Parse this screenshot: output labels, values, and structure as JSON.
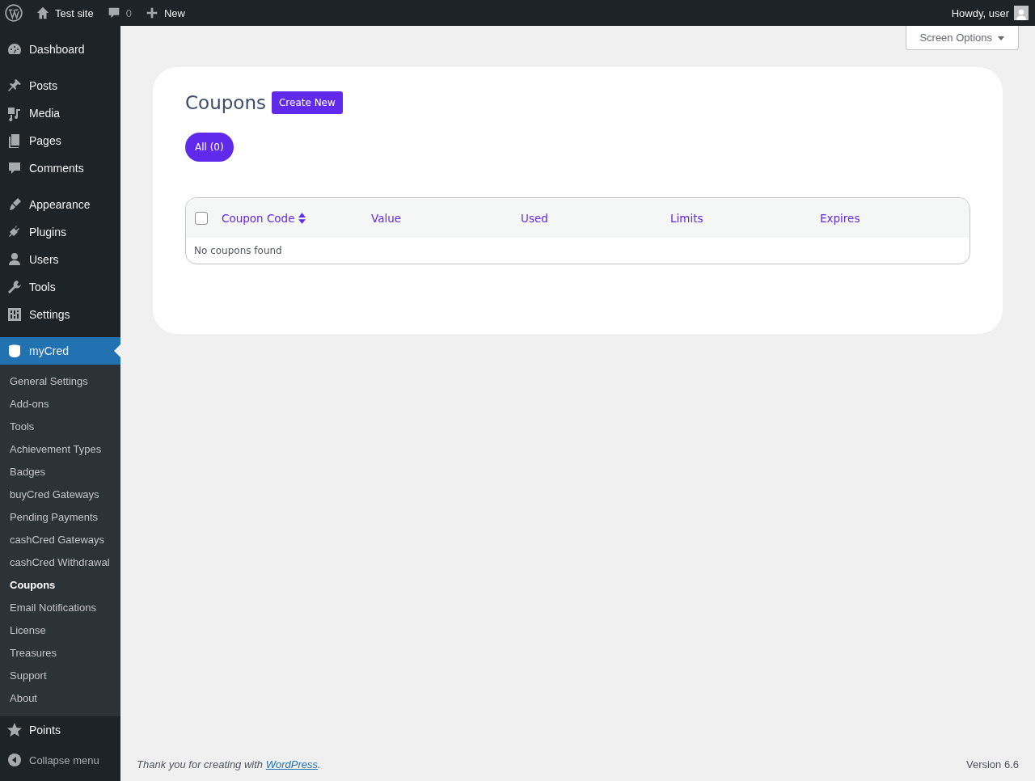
{
  "admin_bar": {
    "site": "Test site",
    "comments": "0",
    "new": "New",
    "greeting": "Howdy, user"
  },
  "sidebar": {
    "groups": [
      [
        {
          "label": "Dashboard",
          "selected": false
        }
      ],
      [
        {
          "label": "Posts",
          "selected": false
        },
        {
          "label": "Media",
          "selected": false
        },
        {
          "label": "Pages",
          "selected": false
        },
        {
          "label": "Comments",
          "selected": false
        }
      ],
      [
        {
          "label": "Appearance",
          "selected": false
        },
        {
          "label": "Plugins",
          "selected": false
        },
        {
          "label": "Users",
          "selected": false
        },
        {
          "label": "Tools",
          "selected": false
        },
        {
          "label": "Settings",
          "selected": false
        }
      ],
      [
        {
          "label": "myCred",
          "selected": true,
          "children": [
            {
              "label": "General Settings",
              "selected": false
            },
            {
              "label": "Add-ons",
              "selected": false
            },
            {
              "label": "Tools",
              "selected": false
            },
            {
              "label": "Achievement Types",
              "selected": false
            },
            {
              "label": "Badges",
              "selected": false
            },
            {
              "label": "buyCred Gateways",
              "selected": false
            },
            {
              "label": "Pending Payments",
              "selected": false
            },
            {
              "label": "cashCred Gateways",
              "selected": false
            },
            {
              "label": "cashCred Withdrawal",
              "selected": false
            },
            {
              "label": "Coupons",
              "selected": true
            },
            {
              "label": "Email Notifications",
              "selected": false
            },
            {
              "label": "License",
              "selected": false
            },
            {
              "label": "Treasures",
              "selected": false
            },
            {
              "label": "Support",
              "selected": false
            },
            {
              "label": "About",
              "selected": false
            }
          ]
        },
        {
          "label": "Points",
          "selected": false
        }
      ]
    ],
    "collapse": "Collapse menu"
  },
  "screen_options": "Screen Options",
  "page": {
    "title": "Coupons",
    "create_button": "Create New",
    "filters": [
      {
        "label": "All (0)",
        "selected": true
      }
    ],
    "table": {
      "select_all_checked": false,
      "columns": [
        {
          "label": "Coupon Code",
          "sortable": true
        },
        {
          "label": "Value",
          "sortable": false
        },
        {
          "label": "Used",
          "sortable": false
        },
        {
          "label": "Limits",
          "sortable": false
        },
        {
          "label": "Expires",
          "sortable": false
        }
      ],
      "empty_message": "No coupons found"
    }
  },
  "footer": {
    "text": "Thank you for creating with",
    "link": "WordPress",
    "end": ".",
    "version": "Version 6.6"
  }
}
